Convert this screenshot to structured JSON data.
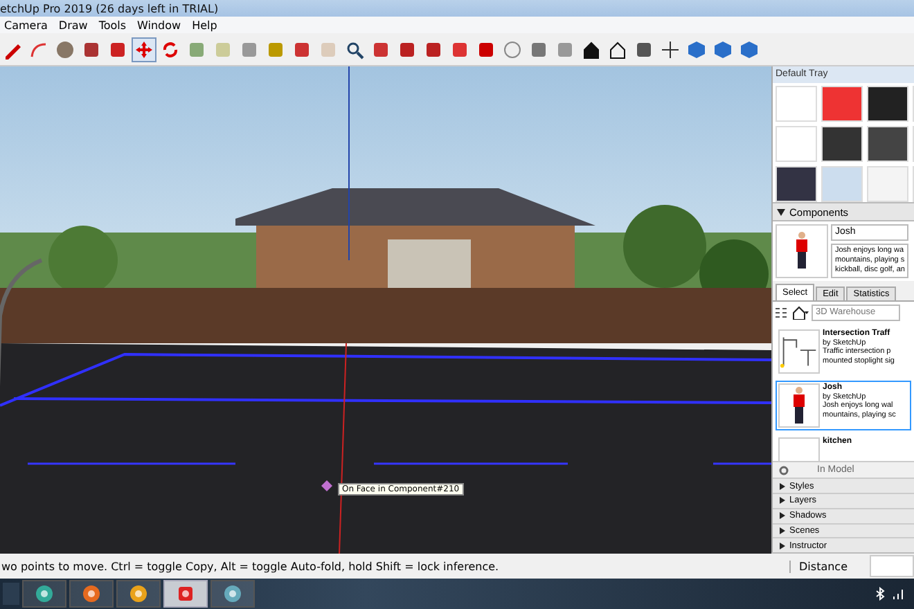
{
  "window": {
    "title": "etchUp Pro 2019 (26 days left in TRIAL)"
  },
  "menu": [
    "Camera",
    "Draw",
    "Tools",
    "Window",
    "Help"
  ],
  "tools": [
    {
      "kind": "pencil",
      "selected": false
    },
    {
      "kind": "arc",
      "selected": false
    },
    {
      "kind": "circle",
      "selected": false
    },
    {
      "kind": "pushpull",
      "selected": false
    },
    {
      "kind": "followme",
      "selected": false
    },
    {
      "kind": "move",
      "selected": true
    },
    {
      "kind": "rotate",
      "selected": false
    },
    {
      "kind": "scale",
      "selected": false
    },
    {
      "kind": "tape",
      "selected": false
    },
    {
      "kind": "text",
      "selected": false
    },
    {
      "kind": "paint",
      "selected": false
    },
    {
      "kind": "orbit",
      "selected": false
    },
    {
      "kind": "pan",
      "selected": false
    },
    {
      "kind": "zoom",
      "selected": false
    },
    {
      "kind": "extents",
      "selected": false
    },
    {
      "kind": "warehouse",
      "selected": false
    },
    {
      "kind": "warehouse",
      "selected": false
    },
    {
      "kind": "share",
      "selected": false
    },
    {
      "kind": "ruby",
      "selected": false
    },
    {
      "kind": "account",
      "selected": false
    },
    {
      "kind": "iso",
      "selected": false
    },
    {
      "kind": "top",
      "selected": false
    },
    {
      "kind": "home",
      "selected": false
    },
    {
      "kind": "homeoutline",
      "selected": false
    },
    {
      "kind": "section",
      "selected": false
    },
    {
      "kind": "axes",
      "selected": false
    },
    {
      "kind": "cube",
      "selected": false
    },
    {
      "kind": "cube",
      "selected": false
    },
    {
      "kind": "cube",
      "selected": false
    }
  ],
  "viewport": {
    "tooltip": "On Face in Component#210"
  },
  "tray": {
    "title": "Default Tray",
    "components": {
      "title": "Components",
      "name": "Josh",
      "description": [
        "Josh enjoys long wa",
        "mountains, playing s",
        "kickball, disc golf, an"
      ],
      "tabs": [
        {
          "label": "Select",
          "selected": true
        },
        {
          "label": "Edit",
          "selected": false
        },
        {
          "label": "Statistics",
          "selected": false
        }
      ],
      "search": {
        "placeholder": "3D Warehouse"
      },
      "items": [
        {
          "name": "Intersection Traff",
          "author": "by SketchUp",
          "lines": [
            "Traffic intersection p",
            "mounted stoplight sig"
          ],
          "selected": false,
          "kind": "traffic"
        },
        {
          "name": "Josh",
          "author": "by SketchUp",
          "lines": [
            "Josh enjoys long wal",
            "mountains, playing sc"
          ],
          "selected": true,
          "kind": "person"
        },
        {
          "name": "kitchen",
          "selected": false,
          "kind": "blank"
        }
      ],
      "footer": "In Model"
    },
    "panels": [
      "Styles",
      "Layers",
      "Shadows",
      "Scenes",
      "Instructor"
    ]
  },
  "status_bar": {
    "message": "wo points to move.  Ctrl = toggle Copy, Alt = toggle Auto-fold, hold Shift = lock inference.",
    "measure_label": "Distance"
  },
  "taskbar": [
    {
      "kind": "chrome",
      "selected": false
    },
    {
      "kind": "firefox",
      "selected": false
    },
    {
      "kind": "shield",
      "selected": false
    },
    {
      "kind": "sketchup",
      "selected": true
    },
    {
      "kind": "paint",
      "selected": false
    }
  ]
}
